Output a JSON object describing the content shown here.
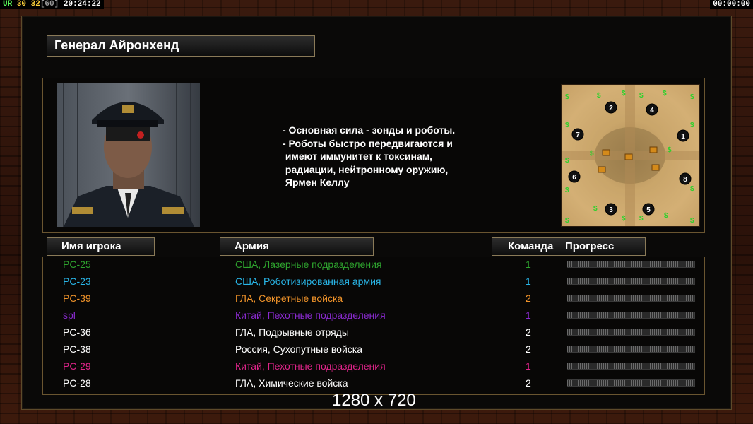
{
  "hud": {
    "ur_label": "UR",
    "fps": "30",
    "fps_cap": "32",
    "fps_bracket": "[60]",
    "time": "20:24:22",
    "timer": "00:00:00"
  },
  "general": {
    "name": "Генерал Айронхенд"
  },
  "description": [
    "- Основная сила - зонды и роботы.",
    "- Роботы быстро передвигаются и",
    " имеют иммунитет к токсинам,",
    " радиации, нейтронному оружию,",
    " Ярмен Келлу"
  ],
  "headers": {
    "player_name": "Имя игрока",
    "army": "Армия",
    "team": "Команда",
    "progress": "Прогресс"
  },
  "players": [
    {
      "name": "PC-25",
      "army": "США, Лазерные подразделения",
      "team": "1",
      "color": "#2ea32e",
      "progress": 0
    },
    {
      "name": "PC-23",
      "army": "США, Роботизированная армия",
      "team": "1",
      "color": "#29b6e8",
      "progress": 0
    },
    {
      "name": "PC-39",
      "army": "ГЛА, Секретные войска",
      "team": "2",
      "color": "#f0932a",
      "progress": 0
    },
    {
      "name": "spl",
      "army": "Китай, Пехотные подразделения",
      "team": "1",
      "color": "#8a2ad0",
      "progress": 0
    },
    {
      "name": "PC-36",
      "army": "ГЛА, Подрывные отряды",
      "team": "2",
      "color": "#ffffff",
      "progress": 0
    },
    {
      "name": "PC-38",
      "army": "Россия, Сухопутные войска",
      "team": "2",
      "color": "#ffffff",
      "progress": 0
    },
    {
      "name": "PC-29",
      "army": "Китай, Пехотные подразделения",
      "team": "1",
      "color": "#e0248a",
      "progress": 0
    },
    {
      "name": "PC-28",
      "army": "ГЛА, Химические войска",
      "team": "2",
      "color": "#ffffff",
      "progress": 0
    }
  ],
  "minimap": {
    "start_positions": [
      "1",
      "2",
      "3",
      "4",
      "5",
      "6",
      "7",
      "8"
    ],
    "resource_marker": "$"
  },
  "resolution_label": "1280 x 720"
}
